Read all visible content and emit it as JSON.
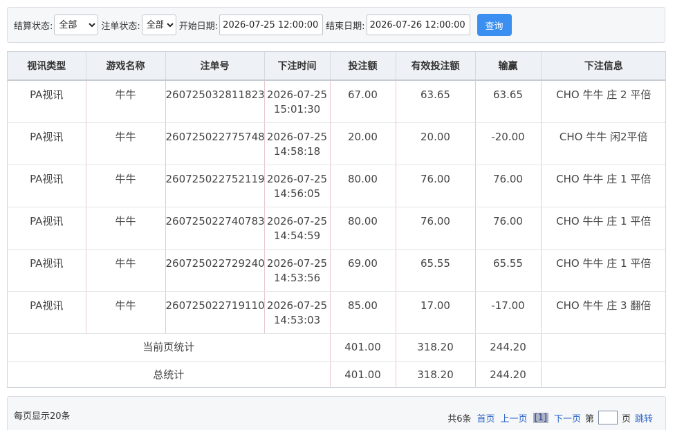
{
  "filters": {
    "settle_label": "结算状态:",
    "settle_value": "全部",
    "cancel_label": "注单状态:",
    "cancel_value": "全部",
    "start_label": "开始日期:",
    "start_value": "2026-07-25 12:00:00",
    "end_label": "结束日期:",
    "end_value": "2026-07-26 12:00:00",
    "query_label": "查询"
  },
  "table": {
    "headers": [
      "视讯类型",
      "游戏名称",
      "注单号",
      "下注时间",
      "投注额",
      "有效投注额",
      "输赢",
      "下注信息"
    ],
    "rows": [
      {
        "type": "PA视讯",
        "game": "牛牛",
        "bet_no": "260725032811823",
        "date": "2026-07-25",
        "time": "15:01:30",
        "amount": "67.00",
        "valid": "63.65",
        "winloss": "63.65",
        "info": "CHO 牛牛 庄 2 平倍"
      },
      {
        "type": "PA视讯",
        "game": "牛牛",
        "bet_no": "260725022775748",
        "date": "2026-07-25",
        "time": "14:58:18",
        "amount": "20.00",
        "valid": "20.00",
        "winloss": "-20.00",
        "info": "CHO 牛牛 闲2平倍"
      },
      {
        "type": "PA视讯",
        "game": "牛牛",
        "bet_no": "260725022752119",
        "date": "2026-07-25",
        "time": "14:56:05",
        "amount": "80.00",
        "valid": "76.00",
        "winloss": "76.00",
        "info": "CHO 牛牛 庄 1 平倍"
      },
      {
        "type": "PA视讯",
        "game": "牛牛",
        "bet_no": "260725022740783",
        "date": "2026-07-25",
        "time": "14:54:59",
        "amount": "80.00",
        "valid": "76.00",
        "winloss": "76.00",
        "info": "CHO 牛牛 庄 1 平倍"
      },
      {
        "type": "PA视讯",
        "game": "牛牛",
        "bet_no": "260725022729240",
        "date": "2026-07-25",
        "time": "14:53:56",
        "amount": "69.00",
        "valid": "65.55",
        "winloss": "65.55",
        "info": "CHO 牛牛 庄 1 平倍"
      },
      {
        "type": "PA视讯",
        "game": "牛牛",
        "bet_no": "260725022719110",
        "date": "2026-07-25",
        "time": "14:53:03",
        "amount": "85.00",
        "valid": "17.00",
        "winloss": "-17.00",
        "info": "CHO 牛牛 庄 3 翻倍"
      }
    ],
    "page_total": {
      "label": "当前页统计",
      "amount": "401.00",
      "valid": "318.20",
      "winloss": "244.20"
    },
    "grand_total": {
      "label": "总统计",
      "amount": "401.00",
      "valid": "318.20",
      "winloss": "244.20"
    }
  },
  "pager": {
    "per_page": "每页显示20条",
    "total": "共6条",
    "first": "首页",
    "prev": "上一页",
    "current": "[1]",
    "next": "下一页",
    "goto_prefix": "第",
    "goto_suffix": "页",
    "jump": "跳转"
  }
}
